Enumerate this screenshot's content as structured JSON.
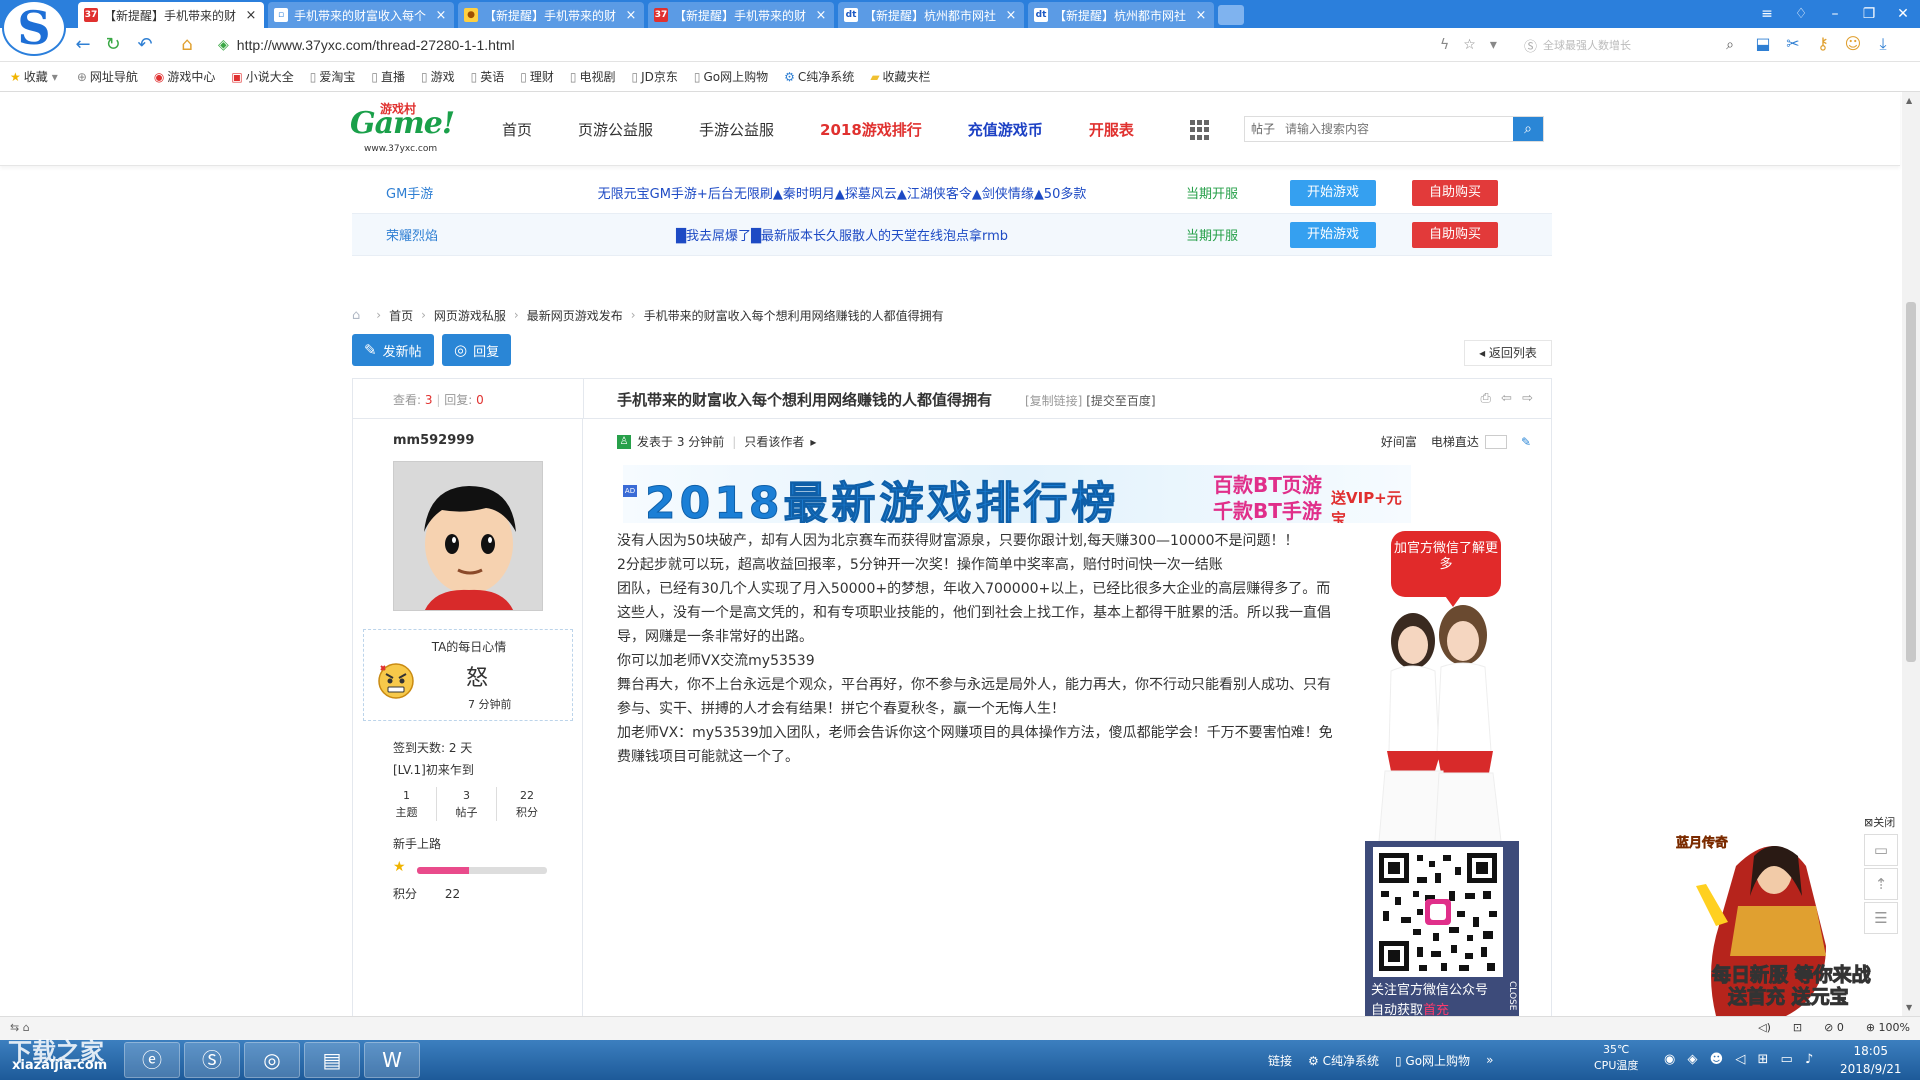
{
  "browser": {
    "tabs": [
      {
        "favicon": "37",
        "title": "【新提醒】手机带来的财",
        "active": true
      },
      {
        "favicon": "",
        "title": "手机带来的财富收入每个",
        "active": false
      },
      {
        "favicon": "",
        "title": "【新提醒】手机带来的财",
        "active": false
      },
      {
        "favicon": "37",
        "title": "【新提醒】手机带来的财",
        "active": false
      },
      {
        "favicon": "dt",
        "title": "【新提醒】杭州都市网社",
        "active": false
      },
      {
        "favicon": "dt",
        "title": "【新提醒】杭州都市网社",
        "active": false
      }
    ],
    "url": "http://www.37yxc.com/thread-27280-1-1.html",
    "search_placeholder": "全球最强人数增长",
    "bookmarks": [
      "收藏",
      "网址导航",
      "游戏中心",
      "小说大全",
      "爱淘宝",
      "直播",
      "游戏",
      "英语",
      "理财",
      "电视剧",
      "JD京东",
      "Go网上购物",
      "C纯净系统",
      "收藏夹栏"
    ]
  },
  "site": {
    "logo_text": "Game!",
    "logo_cn": "游戏村",
    "logo_url": "www.37yxc.com",
    "nav": [
      "首页",
      "页游公益服",
      "手游公益服",
      "2018游戏排行",
      "充值游戏币",
      "开服表"
    ],
    "search_type": "帖子",
    "search_placeholder": "请输入搜索内容"
  },
  "servers": [
    {
      "name": "GM手游",
      "desc": "无限元宝GM手游+后台无限刷▲秦时明月▲探墓风云▲江湖侠客令▲剑侠情缘▲50多款",
      "time": "当期开服",
      "play": "开始游戏",
      "buy": "自助购买"
    },
    {
      "name": "荣耀烈焰",
      "desc": "█我去屌爆了█最新版本长久服散人的天堂在线泡点拿rmb",
      "time": "当期开服",
      "play": "开始游戏",
      "buy": "自助购买"
    }
  ],
  "breadcrumb": [
    "首页",
    "网页游戏私服",
    "最新网页游戏发布",
    "手机带来的财富收入每个想利用网络赚钱的人都值得拥有"
  ],
  "actions": {
    "new_post": "发新帖",
    "reply": "回复",
    "back_list": "返回列表"
  },
  "post": {
    "views_label": "查看:",
    "views": "3",
    "replies_label": "回复:",
    "replies": "0",
    "title": "手机带来的财富收入每个想利用网络赚钱的人都值得拥有",
    "copy_link": "[复制链接]",
    "submit_baidu": "[提交至百度]",
    "posted": "发表于 3 分钟前",
    "author_only": "只看该作者",
    "meta_right1": "好间富",
    "meta_right2": "电梯直达",
    "paragraphs": [
      "没有人因为50块破产，却有人因为北京赛车而获得财富源泉，只要你跟计划,每天赚300—10000不是问题！！",
      "2分起步就可以玩，超高收益回报率，5分钟开一次奖！操作简单中奖率高，赔付时间快一次一结账",
      "团队，已经有30几个人实现了月入50000+的梦想，年收入700000+以上，已经比很多大企业的高层赚得多了。而这些人，没有一个是高文凭的，和有专项职业技能的，他们到社会上找工作，基本上都得干脏累的活。所以我一直倡导，网赚是一条非常好的出路。",
      "你可以加老师VX交流my53539",
      "舞台再大，你不上台永远是个观众，平台再好，你不参与永远是局外人，能力再大，你不行动只能看别人成功、只有参与、实干、拼搏的人才会有结果！拼它个春夏秋冬，赢一个无悔人生！",
      "加老师VX：my53539加入团队，老师会告诉你这个网赚项目的具体操作方法，傻瓜都能学会！千万不要害怕难！免费赚钱项目可能就这一个了。"
    ]
  },
  "author": {
    "name": "mm592999",
    "mood_title": "TA的每日心情",
    "mood_word": "怒",
    "mood_time": "7 分钟前",
    "sign_days": "签到天数: 2 天",
    "level": "[LV.1]初来乍到",
    "stats": [
      {
        "value": "1",
        "label": "主题"
      },
      {
        "value": "3",
        "label": "帖子"
      },
      {
        "value": "22",
        "label": "积分"
      }
    ],
    "rank": "新手上路",
    "level_progress": 0.4,
    "points_label": "积分",
    "points": "22"
  },
  "banner": {
    "ad": "AD",
    "main": "2018最新游戏排行榜",
    "side1": "百款BT页游",
    "side2": "千款BT手游",
    "side3": "送VIP+元宝"
  },
  "side_ad": {
    "bubble": "加官方微信了解更多",
    "qr_caption1": "关注官方微信公众号",
    "qr_caption2_prefix": "自动获取",
    "qr_caption2_hl": "首充",
    "close": "CLOSE"
  },
  "float": {
    "close": "关闭"
  },
  "game_ad": {
    "logo": "蓝月传奇",
    "line1": "每日新服 等你来战",
    "line2": "送首充 送元宝"
  },
  "statusbar": {
    "zoom": "100%",
    "count": "0"
  },
  "taskbar": {
    "watermark": "下载之家",
    "watermark_url": "xiazaijia.com",
    "tray_items": [
      "链接",
      "C纯净系统",
      "Go网上购物"
    ],
    "temp": "35℃",
    "temp_label": "CPU温度",
    "time": "18:05",
    "date": "2018/9/21"
  },
  "colors": {
    "browser_blue": "#2b7fdc",
    "accent_blue": "#2a86d6",
    "red": "#e23a3a",
    "green": "#27a04a"
  }
}
